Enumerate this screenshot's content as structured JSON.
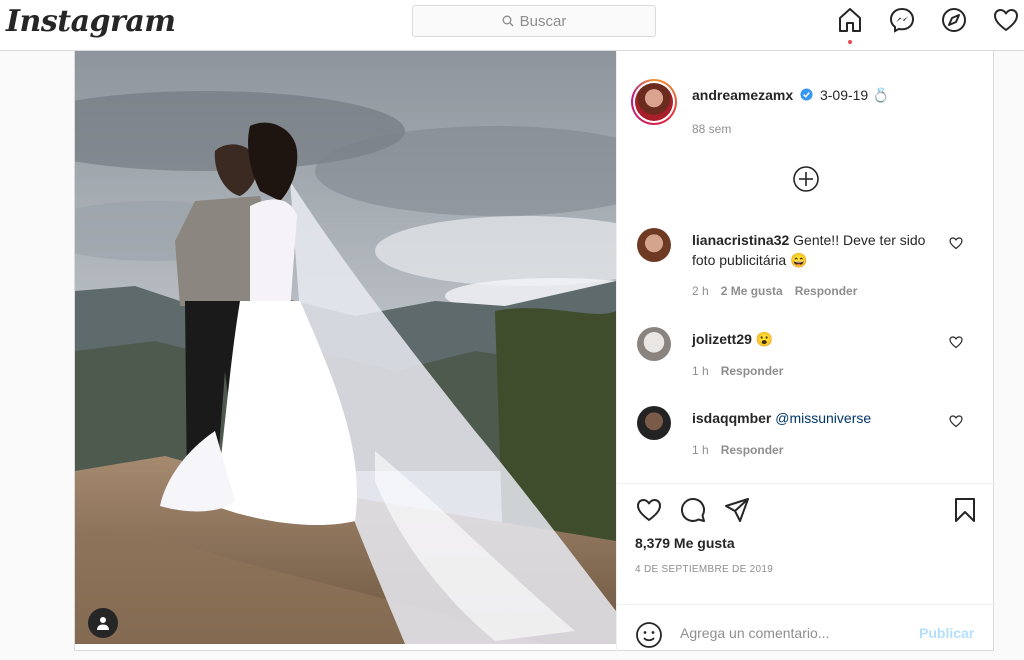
{
  "brand": {
    "logo_text": "Instagram"
  },
  "search": {
    "placeholder": "Buscar"
  },
  "nav": {
    "icons": [
      "home-icon",
      "messenger-icon",
      "explore-compass-icon",
      "activity-heart-icon"
    ],
    "active": "home-icon",
    "notification_dot_color": "#ed4956"
  },
  "post": {
    "author": "andreamezamx",
    "verified": true,
    "caption": "3-09-19",
    "caption_emoji": "💍",
    "age": "88 sem",
    "load_more_icon": "plus-circle-icon",
    "comments": [
      {
        "user": "lianacristina32",
        "text": "Gente!! Deve ter sido foto publicitária",
        "emoji": "😄",
        "time": "2 h",
        "likes": "2 Me gusta",
        "reply": "Responder"
      },
      {
        "user": "jolizett29",
        "text": "",
        "emoji": "😮",
        "time": "1 h",
        "likes": "",
        "reply": "Responder"
      },
      {
        "user": "isdaqqmber",
        "text": "@missuniverse",
        "emoji": "",
        "time": "1 h",
        "likes": "",
        "reply": "Responder"
      }
    ],
    "like_count": "8,379 Me gusta",
    "date": "4 DE SEPTIEMBRE DE 2019",
    "comment_placeholder": "Agrega un comentario...",
    "publish_label": "Publicar"
  },
  "colors": {
    "accent_blue": "#0095f6",
    "publish_disabled": "#b2dffc",
    "verified_blue": "#3897f0",
    "text": "#262626",
    "secondary": "#8e8e8e"
  }
}
